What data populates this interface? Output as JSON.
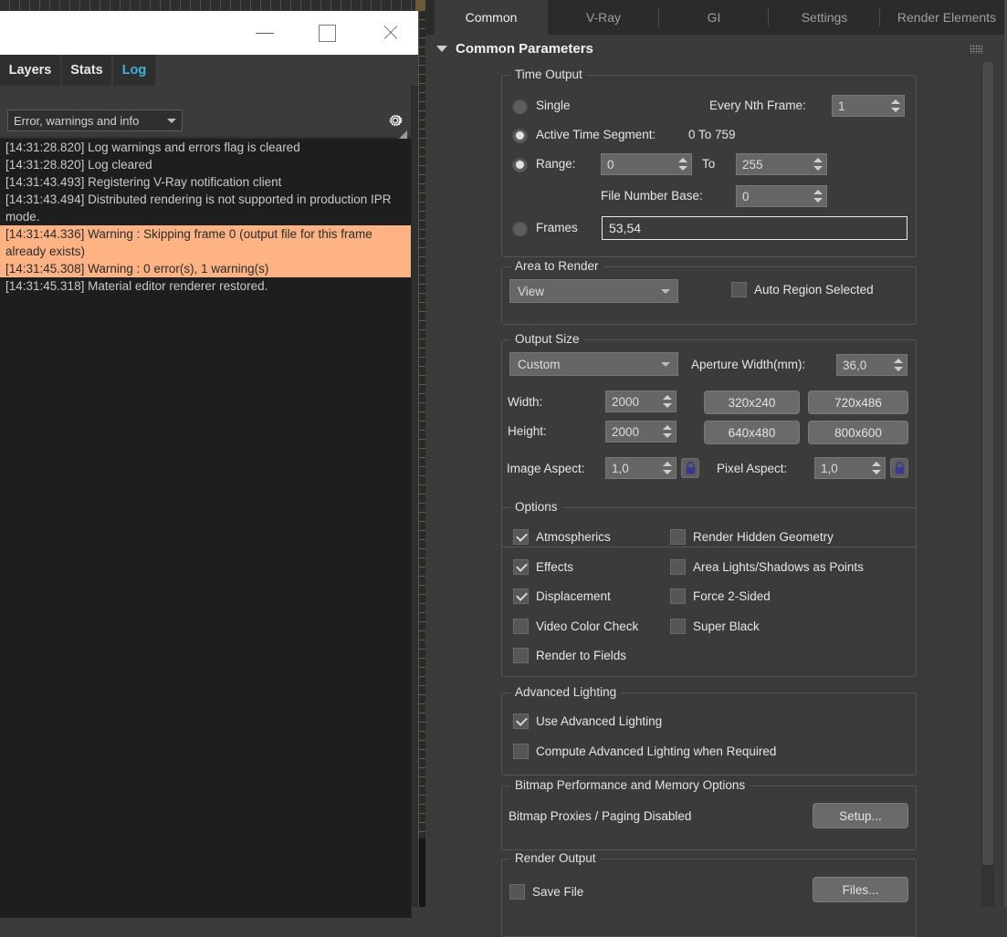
{
  "left_window": {
    "titlebar": {
      "minimize_label": "—",
      "maximize_label": "□",
      "close_label": "✕"
    },
    "tabs": [
      {
        "label": "Layers",
        "active": false
      },
      {
        "label": "Stats",
        "active": false
      },
      {
        "label": "Log",
        "active": true
      }
    ],
    "filter": {
      "selected": "Error, warnings and info"
    },
    "gear_icon": "gear-icon",
    "log_lines": [
      {
        "text": "[14:31:28.820] Log warnings and errors flag is cleared",
        "warning": false
      },
      {
        "text": "[14:31:28.820] Log cleared",
        "warning": false
      },
      {
        "text": "[14:31:43.493] Registering V-Ray notification client",
        "warning": false
      },
      {
        "text": "[14:31:43.494] Distributed rendering is not supported in production IPR mode.",
        "warning": false
      },
      {
        "text": "[14:31:44.336] Warning : Skipping frame 0 (output file for this frame already exists)",
        "warning": true
      },
      {
        "text": "[14:31:45.308] Warning : 0 error(s), 1 warning(s)",
        "warning": true
      },
      {
        "text": "[14:31:45.318] Material editor renderer restored.",
        "warning": false
      }
    ],
    "warning_color": "#ffb384"
  },
  "right_panel": {
    "tabs": [
      {
        "label": "Common",
        "active": true
      },
      {
        "label": "V-Ray",
        "active": false
      },
      {
        "label": "GI",
        "active": false
      },
      {
        "label": "Settings",
        "active": false
      },
      {
        "label": "Render Elements",
        "active": false
      }
    ],
    "rollout": {
      "title": "Common Parameters",
      "expanded": true
    },
    "time_output": {
      "group_label": "Time Output",
      "single_label": "Single",
      "single_selected": false,
      "every_nth_label": "Every Nth Frame:",
      "every_nth_value": "1",
      "active_segment_label": "Active Time Segment:",
      "active_segment_value": "0 To 759",
      "active_segment_selected": true,
      "range_label": "Range:",
      "range_selected": false,
      "range_from": "0",
      "range_to_label": "To",
      "range_to": "255",
      "file_number_base_label": "File Number Base:",
      "file_number_base_value": "0",
      "frames_label": "Frames",
      "frames_selected": false,
      "frames_value": "53,54"
    },
    "area_to_render": {
      "group_label": "Area to Render",
      "selected": "View",
      "auto_region_label": "Auto Region Selected",
      "auto_region_checked": false
    },
    "output_size": {
      "group_label": "Output Size",
      "preset_selected": "Custom",
      "aperture_label": "Aperture Width(mm):",
      "aperture_value": "36,0",
      "width_label": "Width:",
      "width_value": "2000",
      "height_label": "Height:",
      "height_value": "2000",
      "preset_buttons": [
        "320x240",
        "720x486",
        "640x480",
        "800x600"
      ],
      "image_aspect_label": "Image Aspect:",
      "image_aspect_value": "1,0",
      "pixel_aspect_label": "Pixel Aspect:",
      "pixel_aspect_value": "1,0",
      "lock_icon": "lock-icon"
    },
    "options": {
      "group_label": "Options",
      "left_items": [
        {
          "label": "Atmospherics",
          "checked": true
        },
        {
          "label": "Effects",
          "checked": true
        },
        {
          "label": "Displacement",
          "checked": true
        },
        {
          "label": "Video Color Check",
          "checked": false
        },
        {
          "label": "Render to Fields",
          "checked": false
        }
      ],
      "right_items": [
        {
          "label": "Render Hidden Geometry",
          "checked": false
        },
        {
          "label": "Area Lights/Shadows as Points",
          "checked": false
        },
        {
          "label": "Force 2-Sided",
          "checked": false
        },
        {
          "label": "Super Black",
          "checked": false
        }
      ]
    },
    "advanced_lighting": {
      "group_label": "Advanced Lighting",
      "items": [
        {
          "label": "Use Advanced Lighting",
          "checked": true
        },
        {
          "label": "Compute Advanced Lighting when Required",
          "checked": false
        }
      ]
    },
    "bitmap": {
      "group_label": "Bitmap Performance and Memory Options",
      "status_text": "Bitmap Proxies / Paging Disabled",
      "setup_button": "Setup..."
    },
    "render_output": {
      "group_label": "Render Output",
      "save_file_label": "Save File",
      "save_file_checked": false,
      "files_button": "Files..."
    }
  },
  "colors": {
    "panel_bg": "#3b3b3b",
    "log_bg": "#1e1e1e",
    "warning_bg": "#ffb384",
    "active_tab_text": "#3fb3e0",
    "titlebar_bg": "#ffffff",
    "lock_icon": "#3a3a8c"
  }
}
